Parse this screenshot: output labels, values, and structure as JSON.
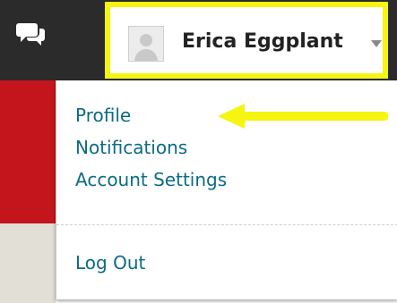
{
  "header": {
    "chat_icon": "chat-bubbles-icon",
    "avatar_icon": "default-avatar-icon",
    "user_name": "Erica Eggplant",
    "caret_icon": "caret-down-icon"
  },
  "dropdown": {
    "profile_label": "Profile",
    "notifications_label": "Notifications",
    "account_settings_label": "Account Settings",
    "logout_label": "Log Out"
  },
  "annotation": {
    "arrow": "left-pointing-arrow",
    "highlight_color": "#f5f50f"
  },
  "colors": {
    "topbar": "#2b2b2b",
    "accent_red": "#c4151c",
    "link": "#0b6b84"
  }
}
